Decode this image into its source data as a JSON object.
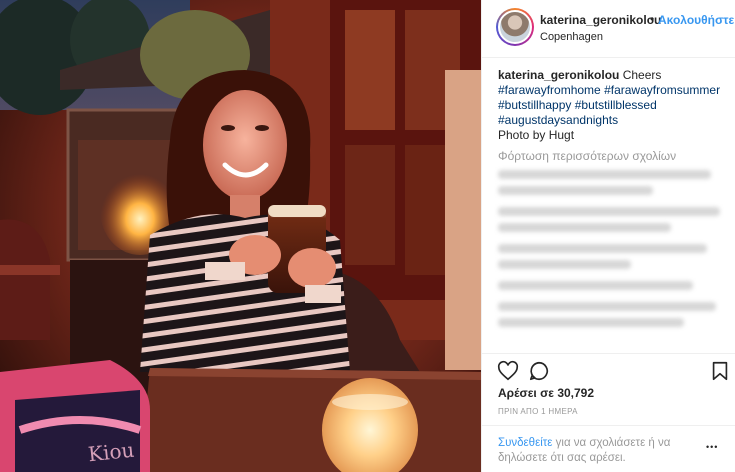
{
  "post": {
    "image": {
      "label_on_blanket": "Kiou"
    },
    "header": {
      "username": "katerina_geronikolou",
      "separator": "•",
      "follow_label": "Ακολουθήστε",
      "location": "Copenhagen",
      "avatar_icon": "profile-avatar"
    },
    "caption": {
      "username": "katerina_geronikolou",
      "text": "Cheers",
      "hashtags": [
        "#farawayfromhome",
        "#farawayfromsummer",
        "#butstillhappy",
        "#butstillblessed",
        "#augustdaysandnights"
      ],
      "credit": "Photo by Hugt"
    },
    "load_more_comments": "Φόρτωση περισσότερων σχολίων",
    "actions": {
      "like_icon": "heart-outline",
      "comment_icon": "speech-bubble",
      "save_icon": "bookmark-outline"
    },
    "likes_text": "Αρέσει σε 30,792",
    "timestamp": "ΠΡΙΝ ΑΠΟ 1 ΗΜΕΡΑ",
    "login_prompt": {
      "link": "Συνδεθείτε",
      "rest": " για να σχολιάσετε ή να δηλώσετε ότι σας αρέσει."
    },
    "more_icon": "ellipsis",
    "more_label": "•••",
    "colors": {
      "link_blue": "#3897f0",
      "hashtag_blue": "#003569",
      "muted_gray": "#999999",
      "text": "#262626",
      "border": "#efefef"
    }
  }
}
